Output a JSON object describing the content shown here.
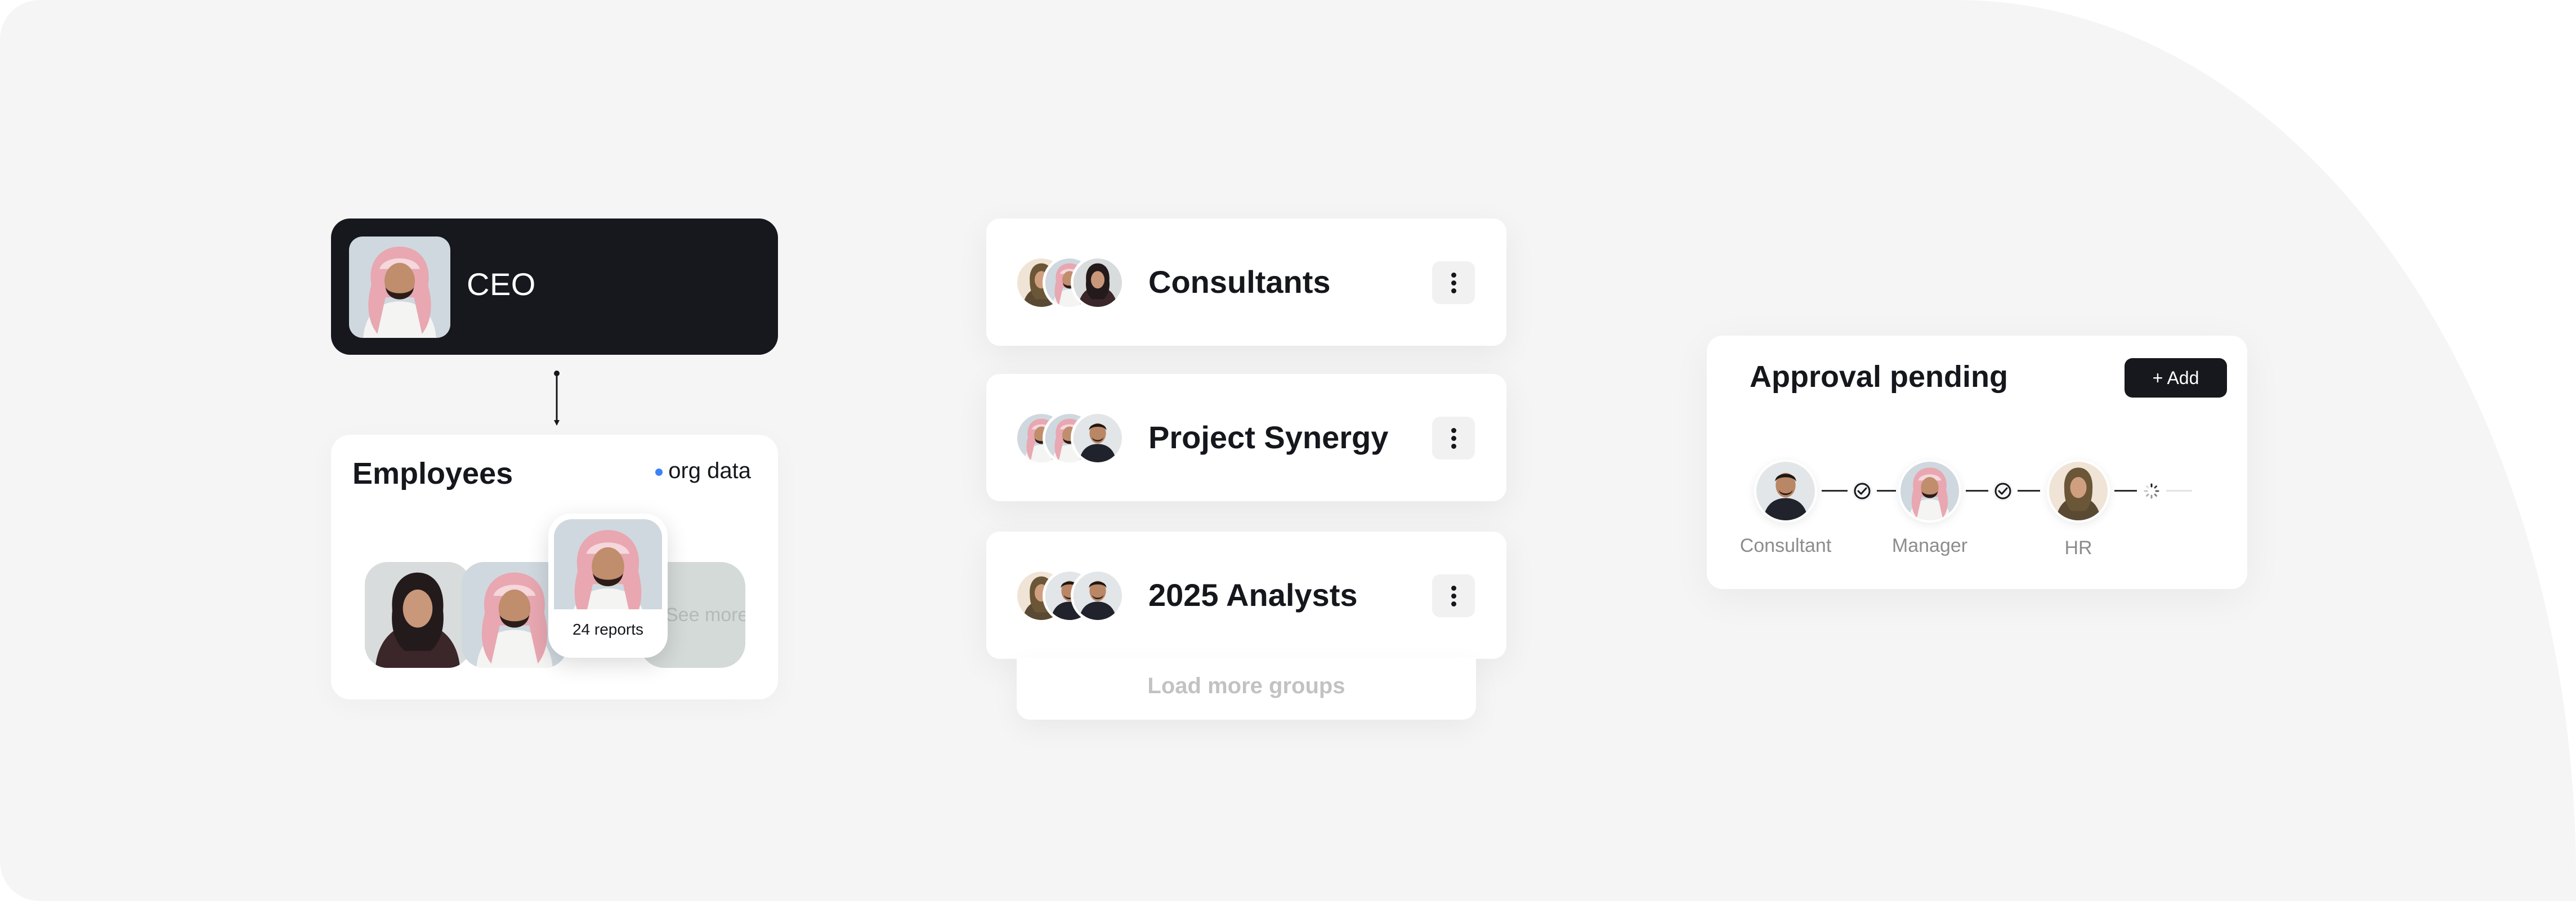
{
  "ceo": {
    "title": "CEO"
  },
  "employees": {
    "title": "Employees",
    "org_data_label": "org data",
    "report_count": "24 reports",
    "see_more_label": "See more"
  },
  "groups": [
    {
      "name": "Consultants"
    },
    {
      "name": "Project Synergy"
    },
    {
      "name": "2025 Analysts"
    }
  ],
  "load_more_label": "Load more groups",
  "approval": {
    "title": "Approval pending",
    "add_label": "+ Add",
    "steps": [
      {
        "label": "Consultant",
        "status": "approved"
      },
      {
        "label": "Manager",
        "status": "approved"
      },
      {
        "label": "HR",
        "status": "pending"
      }
    ]
  },
  "colors": {
    "dark": "#16181d",
    "accent_dot": "#3b82f6",
    "background": "#f5f5f5"
  },
  "icons": [
    "person-photo",
    "more-vertical-icon",
    "check-circle-icon",
    "loading-spinner-icon"
  ]
}
